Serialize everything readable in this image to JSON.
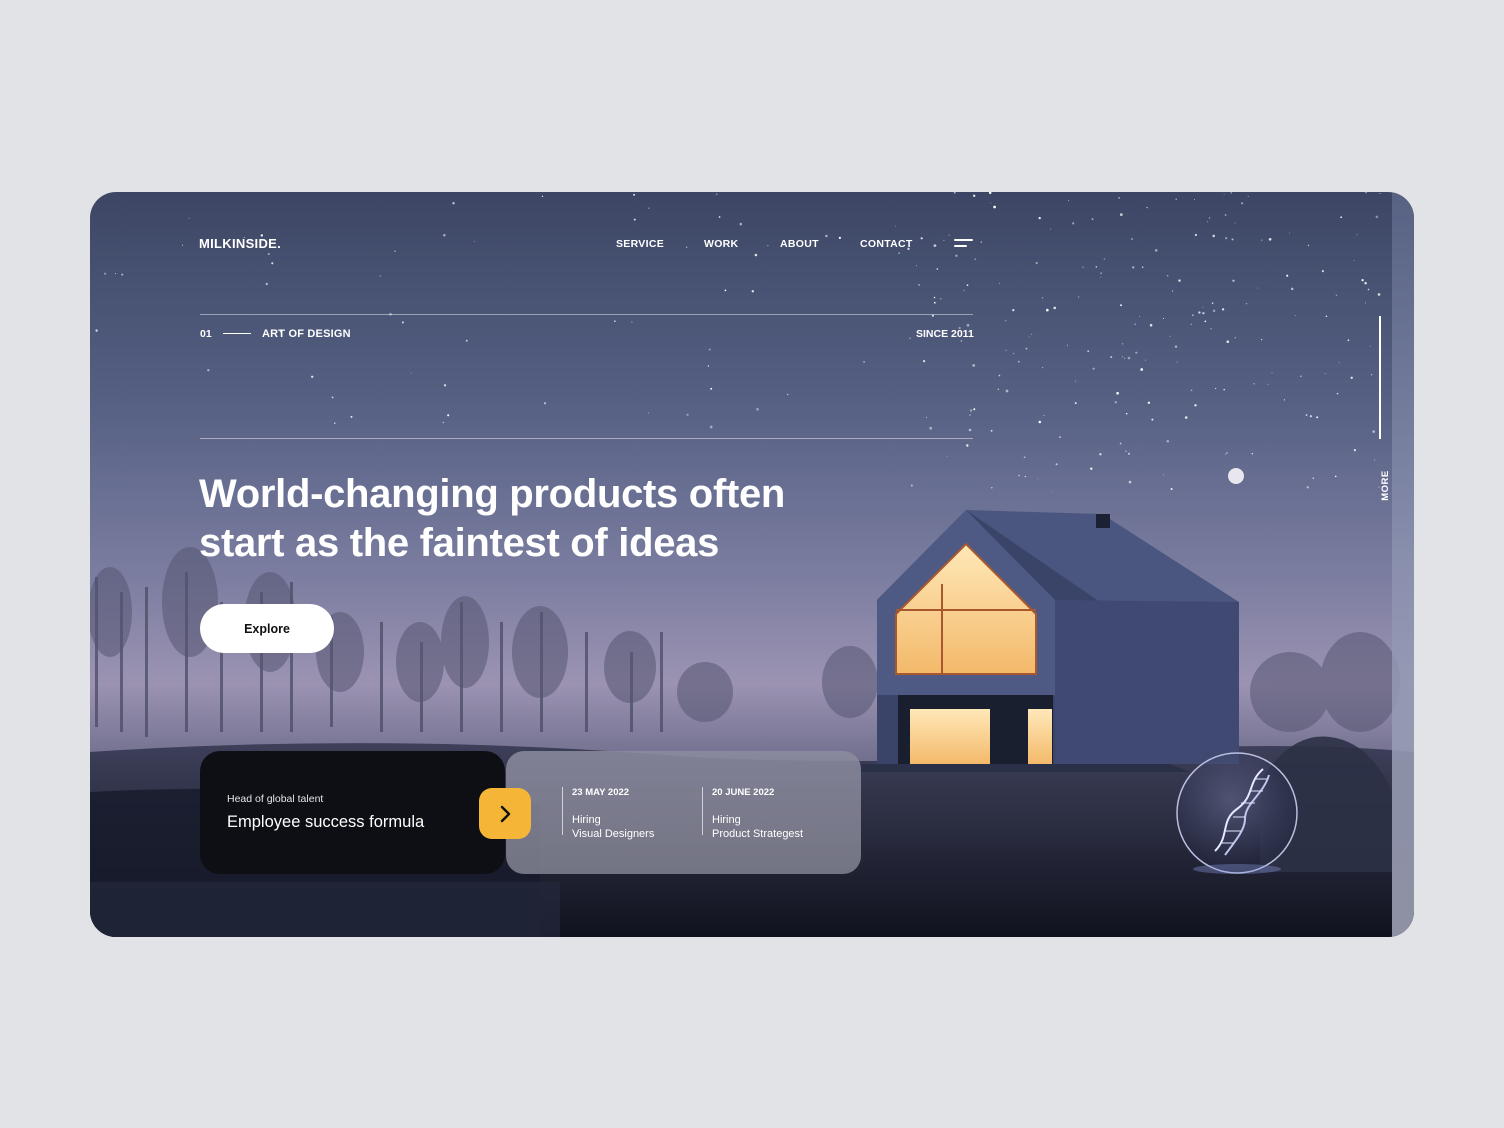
{
  "header": {
    "logo": "MILKINSIDE.",
    "nav": [
      "SERVICE",
      "WORK",
      "ABOUT",
      "CONTACT"
    ]
  },
  "section": {
    "index": "01",
    "label": "ART OF DESIGN",
    "since": "SINCE 2011"
  },
  "hero": {
    "headline_line1": "World-changing products often",
    "headline_line2": "start as the faintest of ideas",
    "cta": "Explore"
  },
  "side": {
    "more": "MORE"
  },
  "talent_card": {
    "eyebrow": "Head of global talent",
    "title": "Employee success formula"
  },
  "jobs": [
    {
      "date": "23 MAY 2022",
      "line1": "Hiring",
      "line2": "Visual Designers"
    },
    {
      "date": "20 JUNE 2022",
      "line1": "Hiring",
      "line2": "Product Strategest"
    }
  ],
  "icons": {
    "menu": "hamburger-menu-icon",
    "arrow": "chevron-right-icon",
    "orb": "dna-icon"
  },
  "colors": {
    "page_bg": "#e2e3e6",
    "accent": "#f5b537",
    "dark_card": "#0e0f14"
  }
}
